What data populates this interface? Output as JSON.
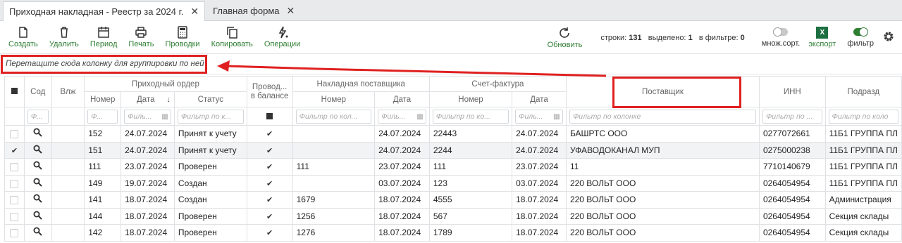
{
  "tabs": [
    {
      "label": "Приходная накладная - Реестр за 2024 г.",
      "active": true
    },
    {
      "label": "Главная форма",
      "active": false
    }
  ],
  "toolbar": {
    "buttons": [
      {
        "label": "Создать",
        "icon": "file-icon"
      },
      {
        "label": "Удалить",
        "icon": "trash-icon"
      },
      {
        "label": "Период",
        "icon": "calendar-icon"
      },
      {
        "label": "Печать",
        "icon": "printer-icon"
      },
      {
        "label": "Проводки",
        "icon": "calculator-icon"
      },
      {
        "label": "Копировать",
        "icon": "copy-icon"
      },
      {
        "label": "Операции",
        "icon": "operations-icon"
      }
    ],
    "refresh_label": "Обновить",
    "stats": {
      "rows_label": "строки:",
      "rows": "131",
      "selected_label": "выделено:",
      "selected": "1",
      "filtered_label": "в фильтре:",
      "filtered": "0"
    },
    "multisort_label": "множ.сорт.",
    "export_label": "экспорт",
    "export_icon_text": "X",
    "filter_label": "фильтр"
  },
  "group_panel": {
    "text": "Перетащите сюда колонку для группировки по ней"
  },
  "grid": {
    "groups": {
      "order": "Приходный ордер",
      "posted": "Провод...",
      "posted2": "в балансе",
      "supplier_invoice": "Накладная поставщика",
      "tax_invoice": "Счет-фактура",
      "supplier": "Поставщик",
      "inn": "ИНН",
      "division": "Подразд"
    },
    "columns": {
      "content": "Сод",
      "attach": "Влж",
      "number": "Номер",
      "date": "Дата",
      "status": "Статус",
      "inv_number": "Номер",
      "inv_date": "Дата",
      "tax_number": "Номер",
      "tax_date": "Дата"
    },
    "filters": {
      "content": "Ф...",
      "number": "Ф...",
      "date": "Филь...",
      "status": "Фильтр по к...",
      "inv_number": "Фильтр по кол...",
      "inv_date": "Филь...",
      "tax_number": "Фильтр по ко...",
      "tax_date": "Филь...",
      "supplier": "Фильтр по колонке",
      "inn": "Фильтр по ...",
      "division": "Фильтр по коло"
    },
    "rows": [
      {
        "checked": false,
        "num": "152",
        "date": "24.07.2024",
        "status": "Принят к учету",
        "posted": true,
        "inv_num": "",
        "inv_date": "24.07.2024",
        "tax_num": "22443",
        "tax_date": "24.07.2024",
        "supplier": "БАШРТС ООО",
        "inn": "0277072661",
        "division": "11Б1 ГРУППА ПЛ"
      },
      {
        "checked": true,
        "num": "151",
        "date": "24.07.2024",
        "status": "Принят к учету",
        "posted": true,
        "inv_num": "",
        "inv_date": "24.07.2024",
        "tax_num": "2244",
        "tax_date": "24.07.2024",
        "supplier": "УФАВОДОКАНАЛ МУП",
        "inn": "0275000238",
        "division": "11Б1 ГРУППА ПЛ"
      },
      {
        "checked": false,
        "num": "111",
        "date": "23.07.2024",
        "status": "Проверен",
        "posted": true,
        "inv_num": "111",
        "inv_date": "23.07.2024",
        "tax_num": "111",
        "tax_date": "23.07.2024",
        "supplier": "11",
        "inn": "7710140679",
        "division": "11Б1 ГРУППА ПЛ"
      },
      {
        "checked": false,
        "num": "149",
        "date": "19.07.2024",
        "status": "Создан",
        "posted": true,
        "inv_num": "",
        "inv_date": "03.07.2024",
        "tax_num": "123",
        "tax_date": "03.07.2024",
        "supplier": "220 ВОЛЬТ ООО",
        "inn": "0264054954",
        "division": "11Б1 ГРУППА ПЛ"
      },
      {
        "checked": false,
        "num": "141",
        "date": "18.07.2024",
        "status": "Создан",
        "posted": true,
        "inv_num": "1679",
        "inv_date": "18.07.2024",
        "tax_num": "4555",
        "tax_date": "18.07.2024",
        "supplier": "220 ВОЛЬТ ООО",
        "inn": "0264054954",
        "division": "Администрация"
      },
      {
        "checked": false,
        "num": "144",
        "date": "18.07.2024",
        "status": "Проверен",
        "posted": true,
        "inv_num": "1256",
        "inv_date": "18.07.2024",
        "tax_num": "567",
        "tax_date": "18.07.2024",
        "supplier": "220 ВОЛЬТ ООО",
        "inn": "0264054954",
        "division": "Секция склады"
      },
      {
        "checked": false,
        "num": "142",
        "date": "18.07.2024",
        "status": "Проверен",
        "posted": true,
        "inv_num": "1276",
        "inv_date": "18.07.2024",
        "tax_num": "1789",
        "tax_date": "18.07.2024",
        "supplier": "220 ВОЛЬТ ООО",
        "inn": "0264054954",
        "division": "Секция склады"
      }
    ]
  },
  "colors": {
    "accent": "#2e7d32",
    "annotation": "#e02020"
  }
}
